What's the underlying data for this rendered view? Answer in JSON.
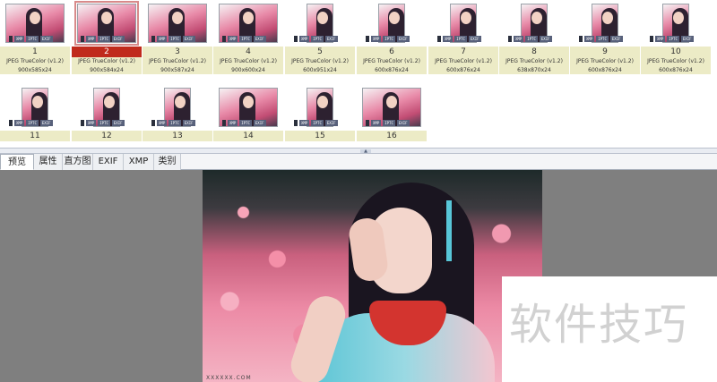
{
  "thumbnails": [
    {
      "number": "1",
      "format": "JPEG TrueColor (v1.2)",
      "dimensions": "900x585x24",
      "orientation": "wide",
      "selected": false
    },
    {
      "number": "2",
      "format": "JPEG TrueColor (v1.2)",
      "dimensions": "900x584x24",
      "orientation": "wide",
      "selected": true
    },
    {
      "number": "3",
      "format": "JPEG TrueColor (v1.2)",
      "dimensions": "900x587x24",
      "orientation": "wide",
      "selected": false
    },
    {
      "number": "4",
      "format": "JPEG TrueColor (v1.2)",
      "dimensions": "900x600x24",
      "orientation": "wide",
      "selected": false
    },
    {
      "number": "5",
      "format": "JPEG TrueColor (v1.2)",
      "dimensions": "600x951x24",
      "orientation": "tall",
      "selected": false
    },
    {
      "number": "6",
      "format": "JPEG TrueColor (v1.2)",
      "dimensions": "600x876x24",
      "orientation": "tall",
      "selected": false
    },
    {
      "number": "7",
      "format": "JPEG TrueColor (v1.2)",
      "dimensions": "600x876x24",
      "orientation": "tall",
      "selected": false
    },
    {
      "number": "8",
      "format": "JPEG TrueColor (v1.2)",
      "dimensions": "638x870x24",
      "orientation": "tall",
      "selected": false
    },
    {
      "number": "9",
      "format": "JPEG TrueColor (v1.2)",
      "dimensions": "600x876x24",
      "orientation": "tall",
      "selected": false
    },
    {
      "number": "10",
      "format": "JPEG TrueColor (v1.2)",
      "dimensions": "600x876x24",
      "orientation": "tall",
      "selected": false
    },
    {
      "number": "11",
      "orientation": "tall",
      "selected": false
    },
    {
      "number": "12",
      "orientation": "tall",
      "selected": false
    },
    {
      "number": "13",
      "orientation": "tall",
      "selected": false
    },
    {
      "number": "14",
      "orientation": "wide",
      "selected": false
    },
    {
      "number": "15",
      "orientation": "tall",
      "selected": false
    },
    {
      "number": "16",
      "orientation": "wide",
      "selected": false
    }
  ],
  "badges": [
    "XMP",
    "IPTC",
    "EXIF"
  ],
  "tabs": [
    "预览",
    "属性",
    "直方图",
    "EXIF",
    "XMP",
    "类别"
  ],
  "active_tab": "预览",
  "preview": {
    "caption": "XXXXXX.COM"
  },
  "watermark": "软件技巧",
  "colors": {
    "selected_label": "#c02a1c",
    "label_background": "#ecebc6",
    "preview_background": "#7f7f7f"
  }
}
